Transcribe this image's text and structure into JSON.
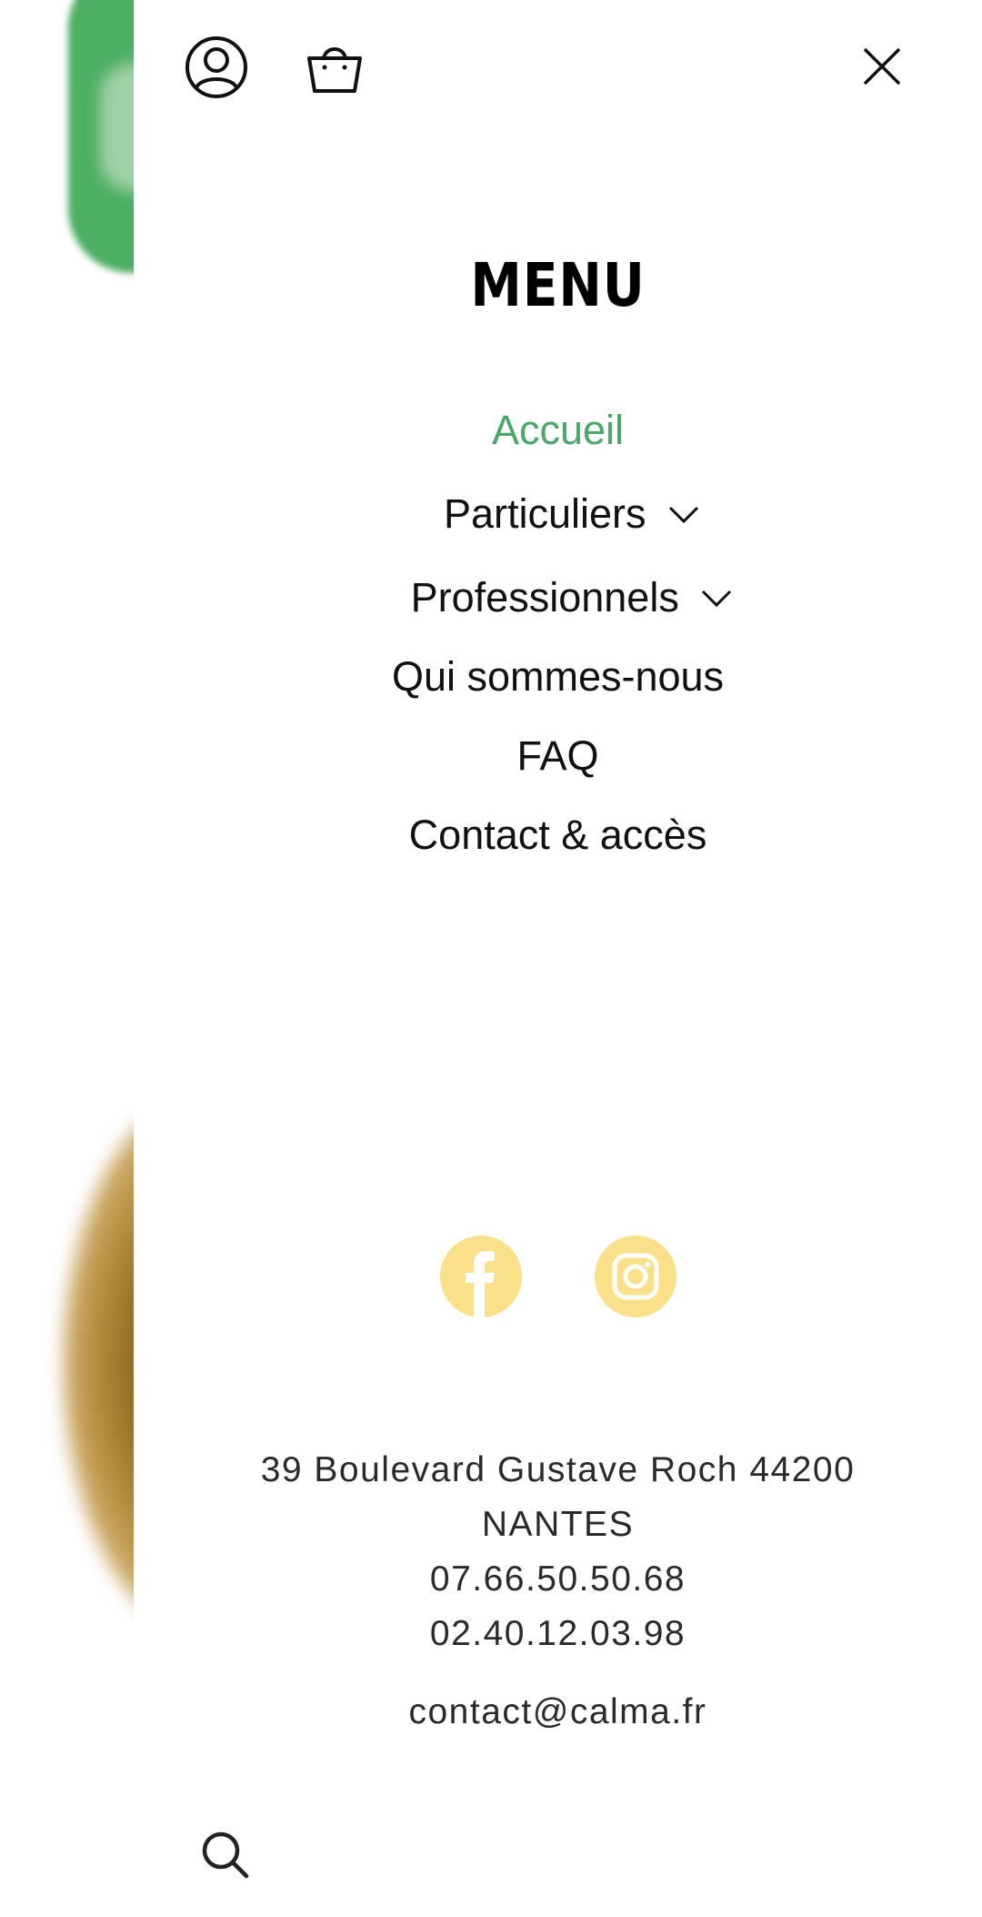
{
  "menu": {
    "title": "MENU",
    "items": [
      {
        "label": "Accueil",
        "active": true,
        "has_submenu": false
      },
      {
        "label": "Particuliers",
        "active": false,
        "has_submenu": true
      },
      {
        "label": "Professionnels",
        "active": false,
        "has_submenu": true
      },
      {
        "label": "Qui sommes-nous",
        "active": false,
        "has_submenu": false
      },
      {
        "label": "FAQ",
        "active": false,
        "has_submenu": false
      },
      {
        "label": "Contact & accès",
        "active": false,
        "has_submenu": false
      }
    ]
  },
  "icons": {
    "account": "user-circle-icon",
    "cart": "shopping-basket-icon",
    "close": "close-icon",
    "facebook": "facebook-icon",
    "instagram": "instagram-icon",
    "search": "search-icon",
    "chevron": "chevron-down-icon"
  },
  "contact": {
    "address_line1": "39 Boulevard Gustave Roch 44200",
    "address_line2": "NANTES",
    "phone1": "07.66.50.50.68",
    "phone2": "02.40.12.03.98",
    "email": "contact@calma.fr"
  },
  "colors": {
    "accent_green": "#4aa76a",
    "social_yellow": "#fbe08a",
    "text": "#111111"
  }
}
